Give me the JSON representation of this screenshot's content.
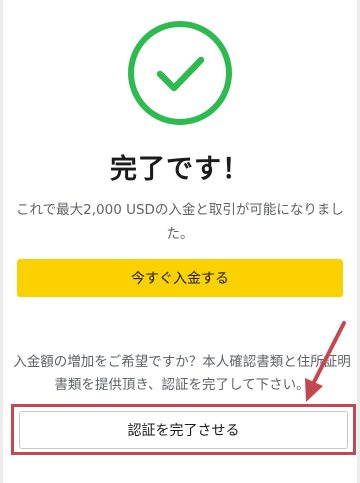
{
  "icons": {
    "success": "check-circle-icon",
    "annotation": "arrow-pointer-icon"
  },
  "colors": {
    "success_green": "#2dba4e",
    "primary_yellow": "#fcd100",
    "highlight_red": "#c5474f"
  },
  "completion": {
    "title": "完了です！",
    "description": "これで最大2,000 USDの入金と取引が可能になりました。"
  },
  "actions": {
    "deposit_label": "今すぐ入金する",
    "verify_label": "認証を完了させる"
  },
  "verification_notice": "入金額の増加をご希望ですか？本人確認書類と住所証明書類を提供頂き、認証を完了して下さい。"
}
